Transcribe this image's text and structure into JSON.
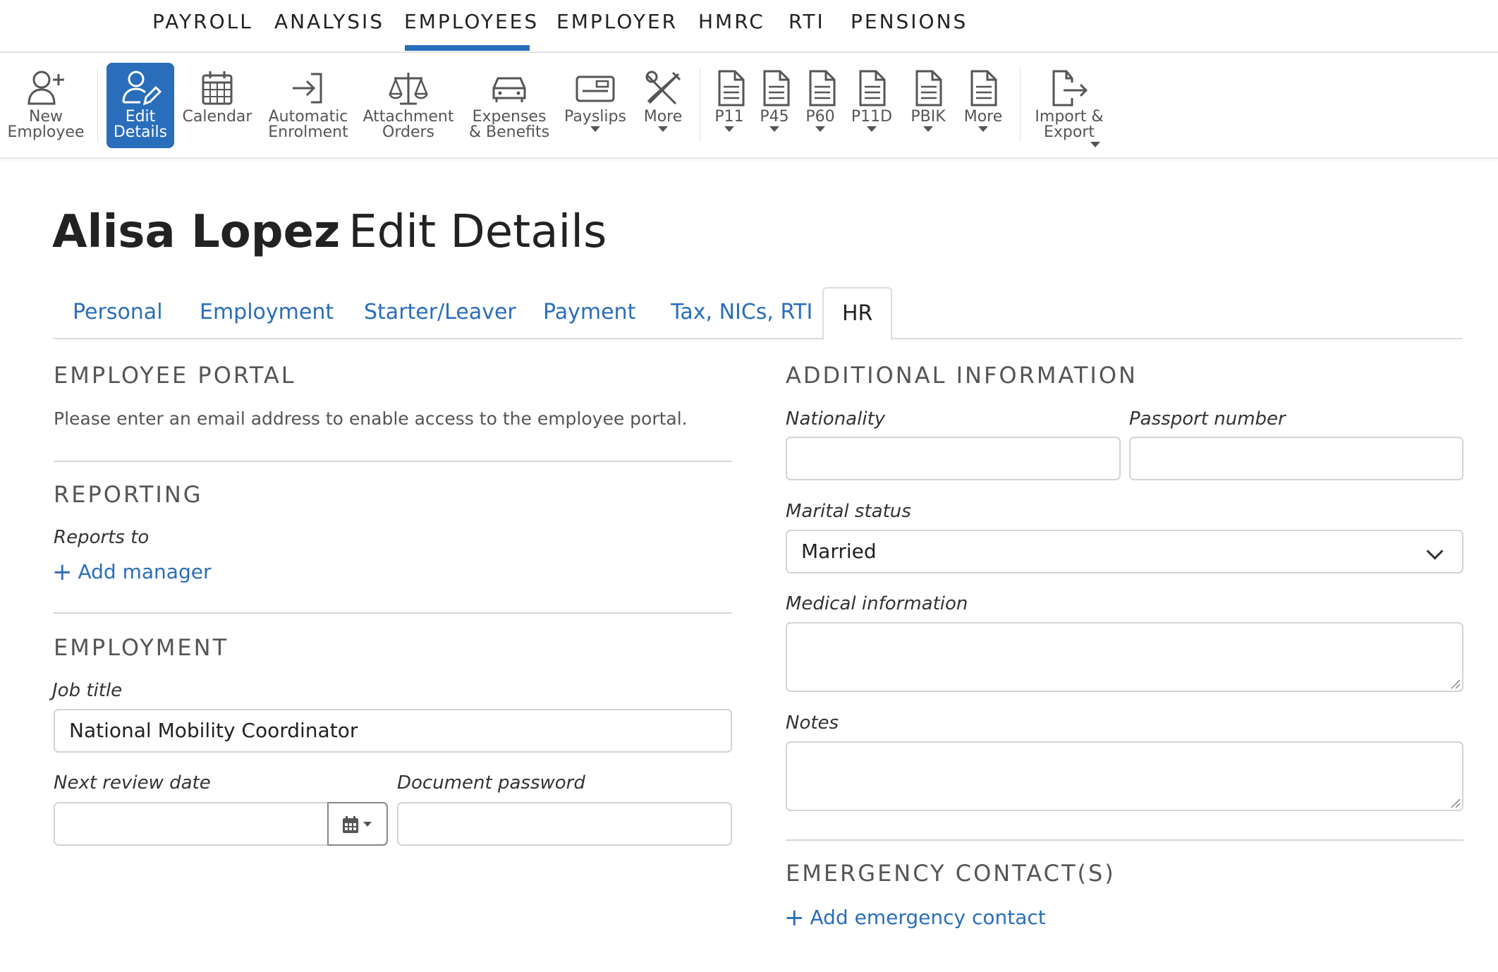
{
  "topnav": {
    "items": [
      "PAYROLL",
      "ANALYSIS",
      "EMPLOYEES",
      "EMPLOYER",
      "HMRC",
      "RTI",
      "PENSIONS"
    ],
    "active": "EMPLOYEES"
  },
  "toolbar": {
    "new_employee": "New\nEmployee",
    "edit_details": "Edit\nDetails",
    "calendar": "Calendar",
    "automatic_enrolment": "Automatic\nEnrolment",
    "attachment_orders": "Attachment\nOrders",
    "expenses_benefits": "Expenses\n& Benefits",
    "payslips": "Payslips",
    "more1": "More",
    "p11": "P11",
    "p45": "P45",
    "p60": "P60",
    "p11d": "P11D",
    "pbik": "PBIK",
    "more2": "More",
    "import_export": "Import &\nExport"
  },
  "page": {
    "employee_name": "Alisa Lopez",
    "subtitle": "Edit Details"
  },
  "tabs": [
    "Personal",
    "Employment",
    "Starter/Leaver",
    "Payment",
    "Tax, NICs, RTI",
    "HR"
  ],
  "left": {
    "portal_heading": "EMPLOYEE PORTAL",
    "portal_help": "Please enter an email address to enable access to the employee portal.",
    "reporting_heading": "REPORTING",
    "reports_to_label": "Reports to",
    "add_manager": "Add manager",
    "employment_heading": "EMPLOYMENT",
    "job_title_label": "Job title",
    "job_title_value": "National Mobility Coordinator",
    "next_review_label": "Next review date",
    "next_review_value": "",
    "doc_password_label": "Document password",
    "doc_password_value": ""
  },
  "right": {
    "additional_heading": "ADDITIONAL INFORMATION",
    "nationality_label": "Nationality",
    "nationality_value": "",
    "passport_label": "Passport number",
    "passport_value": "",
    "marital_label": "Marital status",
    "marital_value": "Married",
    "medical_label": "Medical information",
    "medical_value": "",
    "notes_label": "Notes",
    "notes_value": "",
    "emergency_heading": "EMERGENCY CONTACT(S)",
    "add_emergency": "Add emergency contact"
  },
  "colors": {
    "accent": "#2a6ebb",
    "toolbar_active_bg": "#2a6ebb",
    "text": "#222222",
    "muted": "#555555",
    "border": "#d4d4d4"
  }
}
